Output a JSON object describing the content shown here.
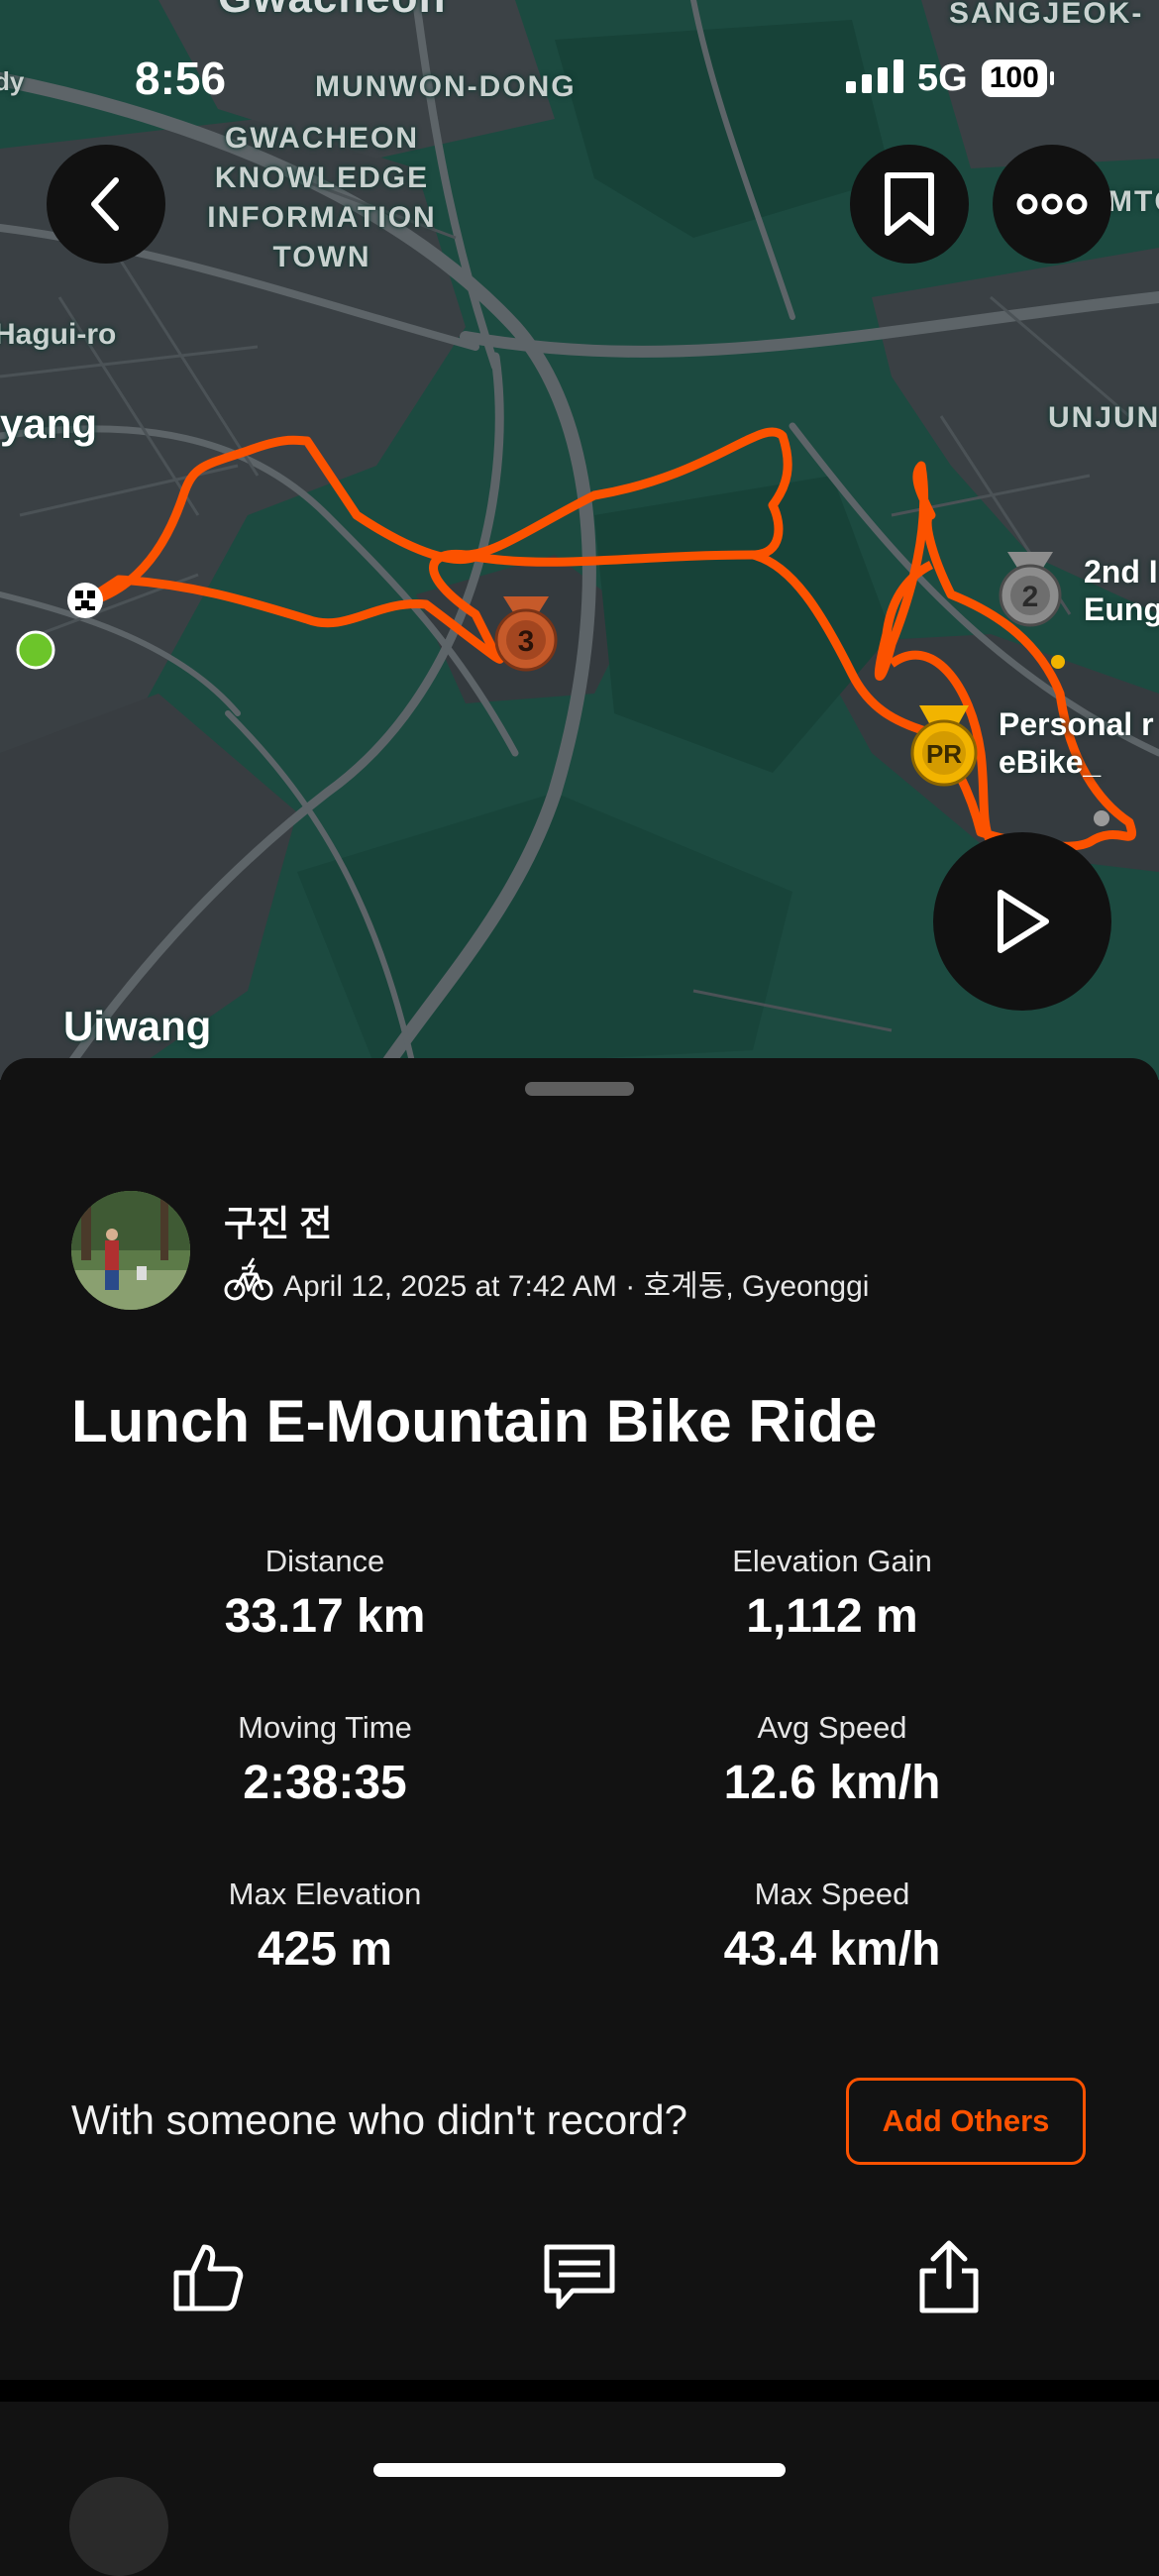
{
  "status_bar": {
    "time": "8:56",
    "network": "5G",
    "battery": "100"
  },
  "map": {
    "labels": {
      "gwacheon": "Gwacheon",
      "munwon": "MUNWON-DONG",
      "gwacheon_knowledge": [
        "GWACHEON",
        "KNOWLEDGE",
        "INFORMATION",
        "TOWN"
      ],
      "sangjeok": "SANGJEOK-",
      "hagui": "Hagui-ro",
      "anyang": "yang",
      "unjun": "UNJUN",
      "uiwang": "Uiwang",
      "mtc": "MTC",
      "dy": "dy"
    },
    "pois": {
      "second_line1": "2nd I",
      "second_line2": "Eung",
      "personal_line1": "Personal r",
      "personal_line2": "eBike_"
    },
    "medals": {
      "third": "3",
      "second": "2",
      "pr": "PR"
    },
    "route_color": "#fc5200"
  },
  "activity": {
    "athlete_name": "구진 전",
    "meta": "April 12, 2025 at 7:42 AM · 호계동, Gyeonggi",
    "title": "Lunch E-Mountain Bike Ride",
    "stats": [
      {
        "label": "Distance",
        "value": "33.17 km"
      },
      {
        "label": "Elevation Gain",
        "value": "1,112 m"
      },
      {
        "label": "Moving Time",
        "value": "2:38:35"
      },
      {
        "label": "Avg Speed",
        "value": "12.6 km/h"
      },
      {
        "label": "Max Elevation",
        "value": "425 m"
      },
      {
        "label": "Max Speed",
        "value": "43.4 km/h"
      }
    ],
    "with_someone": "With someone who didn't record?",
    "add_others": "Add Others"
  },
  "colors": {
    "accent": "#fc5200",
    "sheet_bg": "#121212",
    "map_bg": "#1c4a40",
    "start_green": "#6cc52a"
  }
}
